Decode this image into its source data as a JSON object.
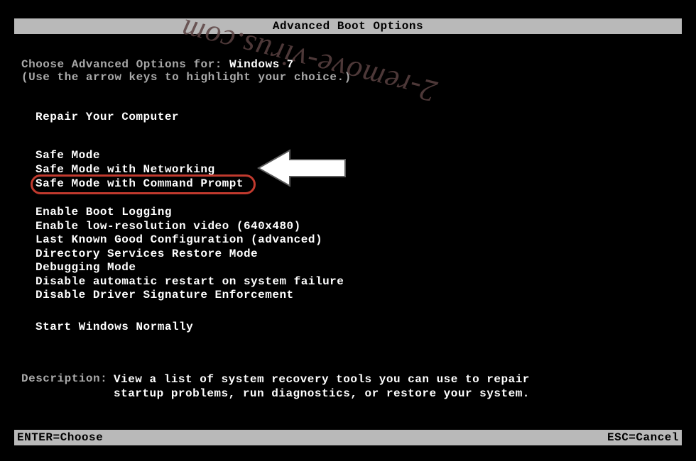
{
  "title": "Advanced Boot Options",
  "choose_prefix": "Choose Advanced Options for: ",
  "os_name": "Windows 7",
  "arrow_hint": "(Use the arrow keys to highlight your choice.)",
  "repair": "Repair Your Computer",
  "menu": {
    "safe_mode": "Safe Mode",
    "safe_mode_net": "Safe Mode with Networking",
    "safe_mode_cmd": "Safe Mode with Command Prompt"
  },
  "group2": {
    "boot_log": "Enable Boot Logging",
    "lowres": "Enable low-resolution video (640x480)",
    "lkg": "Last Known Good Configuration (advanced)",
    "dsrm": "Directory Services Restore Mode",
    "debug": "Debugging Mode",
    "no_restart": "Disable automatic restart on system failure",
    "no_sig": "Disable Driver Signature Enforcement"
  },
  "start_normal": "Start Windows Normally",
  "description_label": "Description:",
  "description_text_1": "View a list of system recovery tools you can use to repair",
  "description_text_2": "startup problems, run diagnostics, or restore your system.",
  "footer": {
    "enter": "ENTER=Choose",
    "esc": "ESC=Cancel"
  },
  "watermark": "2-remove-virus.com"
}
